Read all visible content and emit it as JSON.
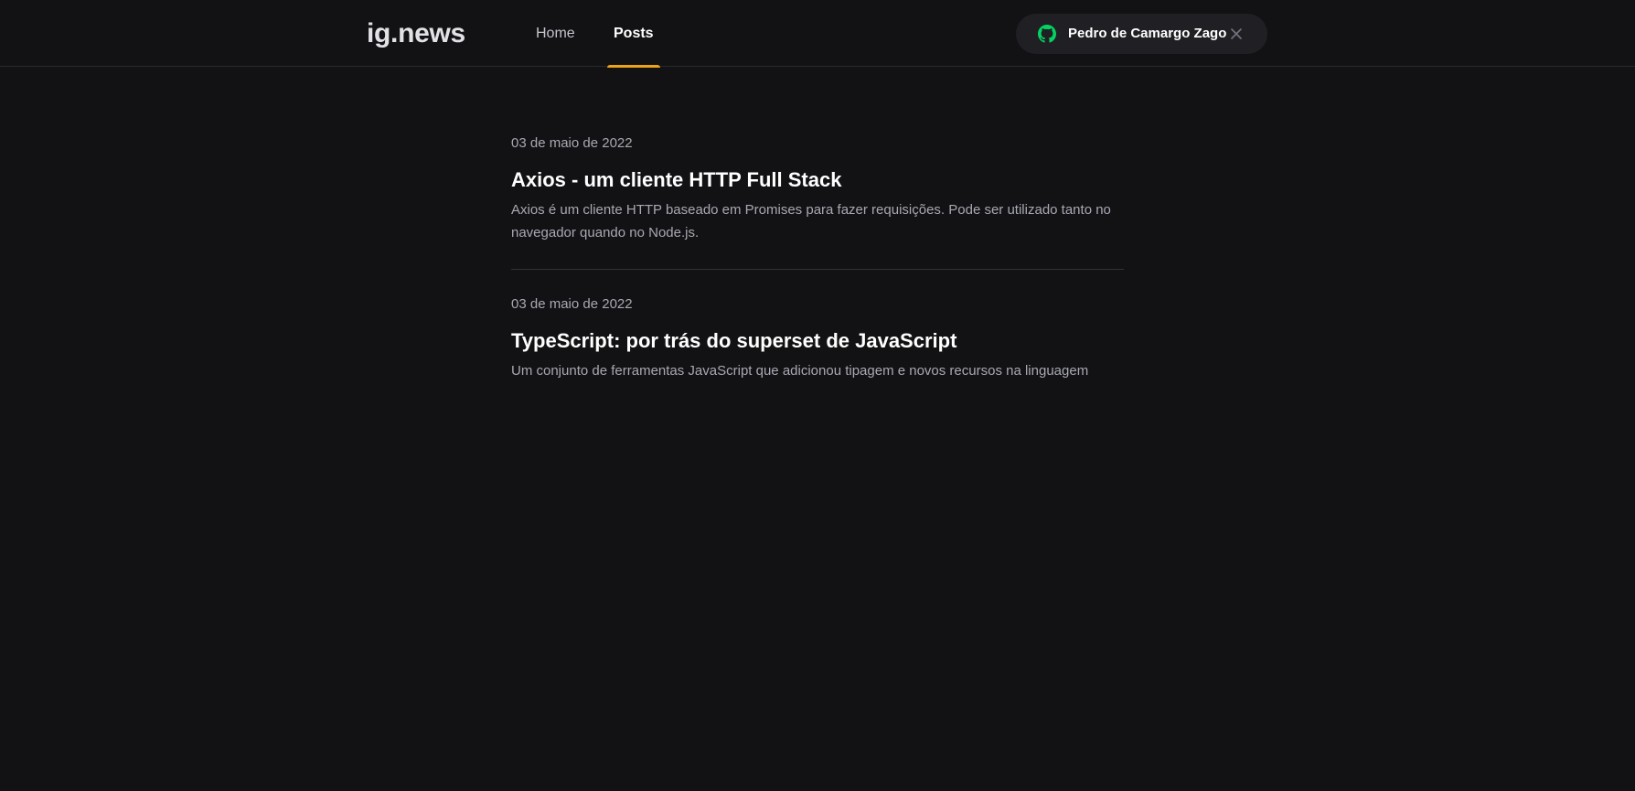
{
  "header": {
    "logo": "ig.news",
    "nav": [
      {
        "label": "Home",
        "active": false
      },
      {
        "label": "Posts",
        "active": true
      }
    ],
    "accent_color": "#eba417",
    "signin": {
      "user_name": "Pedro de Camargo Zago",
      "icon": "github-icon",
      "icon_color": "#04d361",
      "close_icon": "close-icon"
    }
  },
  "posts": [
    {
      "date": "03 de maio de 2022",
      "title": "Axios - um cliente HTTP Full Stack",
      "excerpt": "Axios é um cliente HTTP baseado em Promises para fazer requisições. Pode ser utilizado tanto no navegador quando no Node.js."
    },
    {
      "date": "03 de maio de 2022",
      "title": "TypeScript: por trás do superset de JavaScript",
      "excerpt": "Um conjunto de ferramentas JavaScript que adicionou tipagem e novos recursos na linguagem"
    }
  ]
}
